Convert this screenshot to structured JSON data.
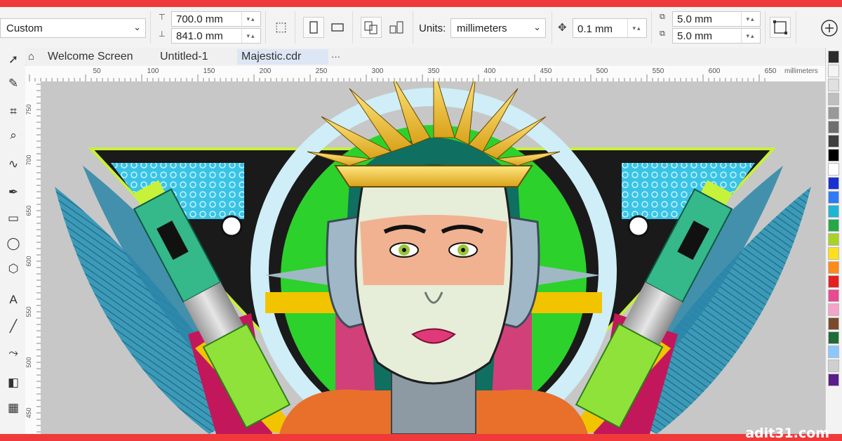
{
  "propbar": {
    "page_size": "Custom",
    "width": "700.0 mm",
    "height": "841.0 mm",
    "units_label": "Units:",
    "units_value": "millimeters",
    "nudge": "0.1 mm",
    "dup_x": "5.0 mm",
    "dup_y": "5.0 mm"
  },
  "tabs": [
    {
      "label": "Welcome Screen"
    },
    {
      "label": "Untitled-1"
    },
    {
      "label": "Majestic.cdr"
    },
    {
      "label": "···"
    }
  ],
  "hruler": {
    "ticks": [
      "50",
      "100",
      "150",
      "200",
      "250",
      "300",
      "350",
      "400",
      "450",
      "500",
      "550",
      "600",
      "650"
    ],
    "unit": "millimeters"
  },
  "vruler": {
    "ticks": [
      "750",
      "700",
      "650",
      "600",
      "550",
      "500",
      "450"
    ]
  },
  "palette": {
    "colors": [
      "#2b2b2b",
      "#f4f4f4",
      "#e0e0e0",
      "#bfbfbf",
      "#999999",
      "#6f6f6f",
      "#3f3f3f",
      "#000000",
      "#ffffff",
      "#1a2fd1",
      "#2f7bf5",
      "#1fb5d4",
      "#25a947",
      "#a8d324",
      "#ffe01a",
      "#ff8a18",
      "#e42020",
      "#e84a8f",
      "#f5a3c7",
      "#7b4a2a",
      "#1f6b3a",
      "#8cc8ff",
      "#cfcfcf",
      "#5a1d8a"
    ]
  },
  "watermark": "adit31.com"
}
